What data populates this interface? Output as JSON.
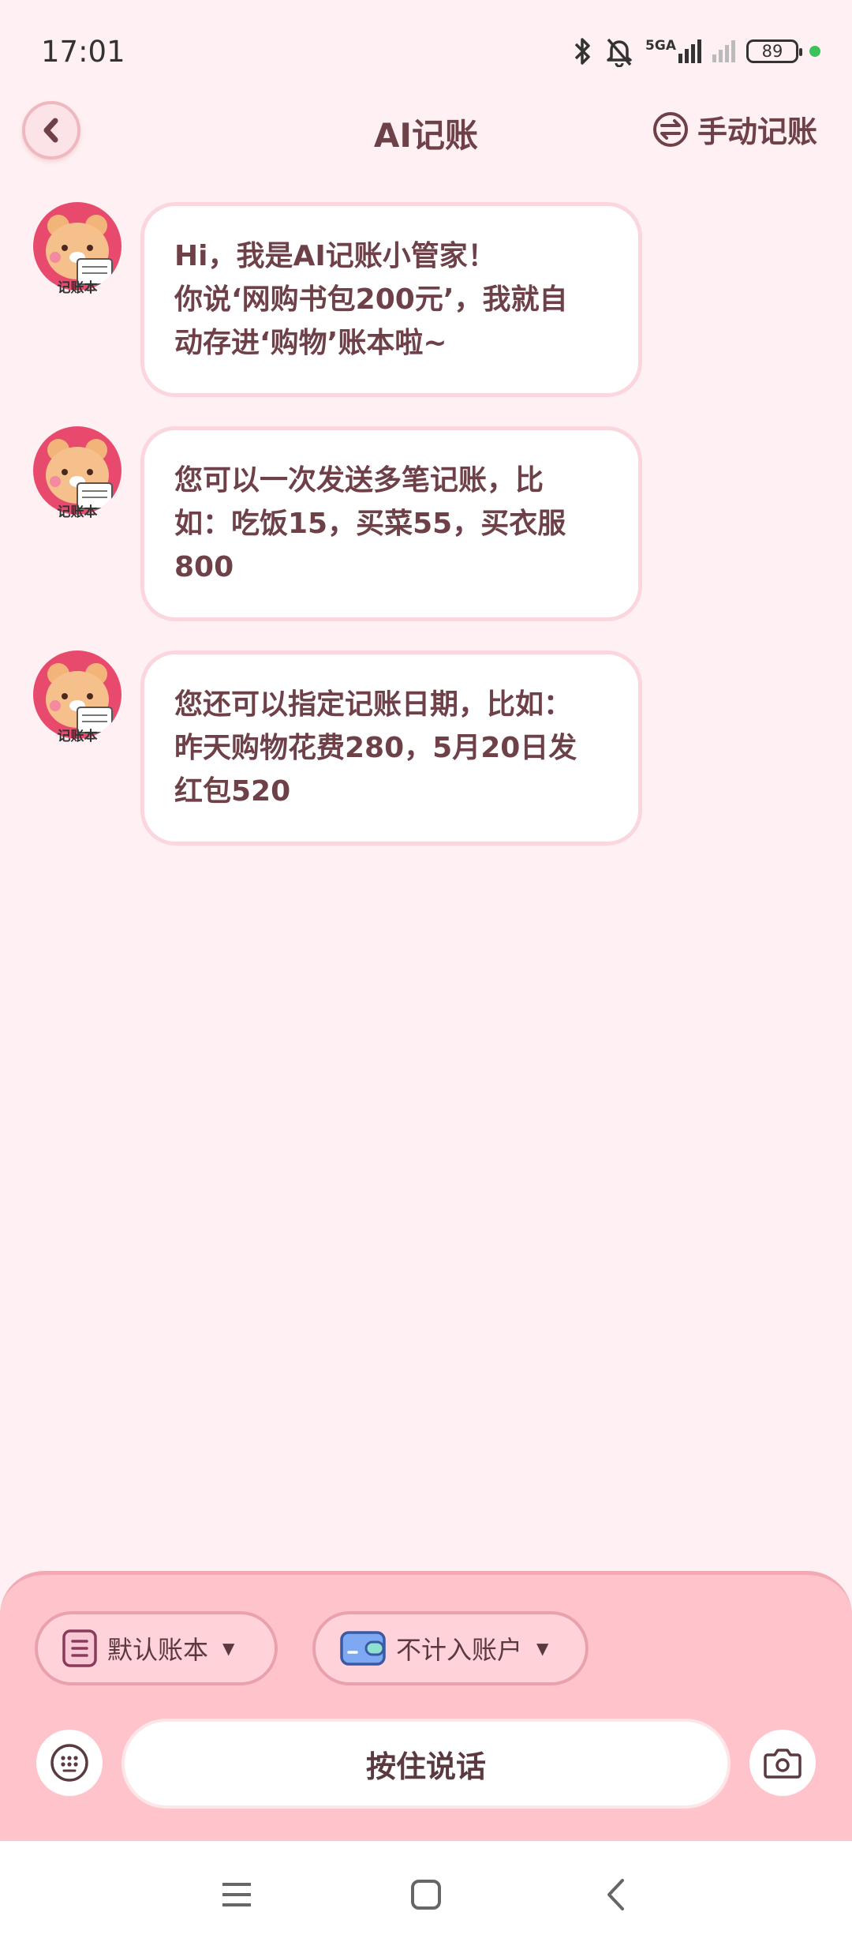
{
  "status_bar": {
    "time": "17:01",
    "network": "5GA",
    "battery": "89",
    "icons": [
      "bluetooth-icon",
      "mute-icon",
      "signal-icon",
      "wifi-icon",
      "battery-icon"
    ]
  },
  "header": {
    "title": "AI记账",
    "manual_label": "手动记账"
  },
  "messages": [
    {
      "avatar_label": "记账本",
      "lines": [
        "Hi，我是AI记账小管家！",
        "你说‘网购书包200元’，我就自",
        "动存进‘购物’账本啦~"
      ]
    },
    {
      "avatar_label": "记账本",
      "lines": [
        "您可以一次发送多笔记账，比",
        "如：吃饭15，买菜55，买衣服",
        "800"
      ]
    },
    {
      "avatar_label": "记账本",
      "lines": [
        "您还可以指定记账日期，比如：",
        "昨天购物花费280，5月20日发",
        "红包520"
      ]
    }
  ],
  "bottom": {
    "book_label": "默认账本",
    "account_label": "不计入账户",
    "voice_label": "按住说话"
  },
  "colors": {
    "background": "#fff1f3",
    "text": "#6e4048",
    "panel": "#ffc4cb",
    "avatar": "#e84a6e"
  }
}
